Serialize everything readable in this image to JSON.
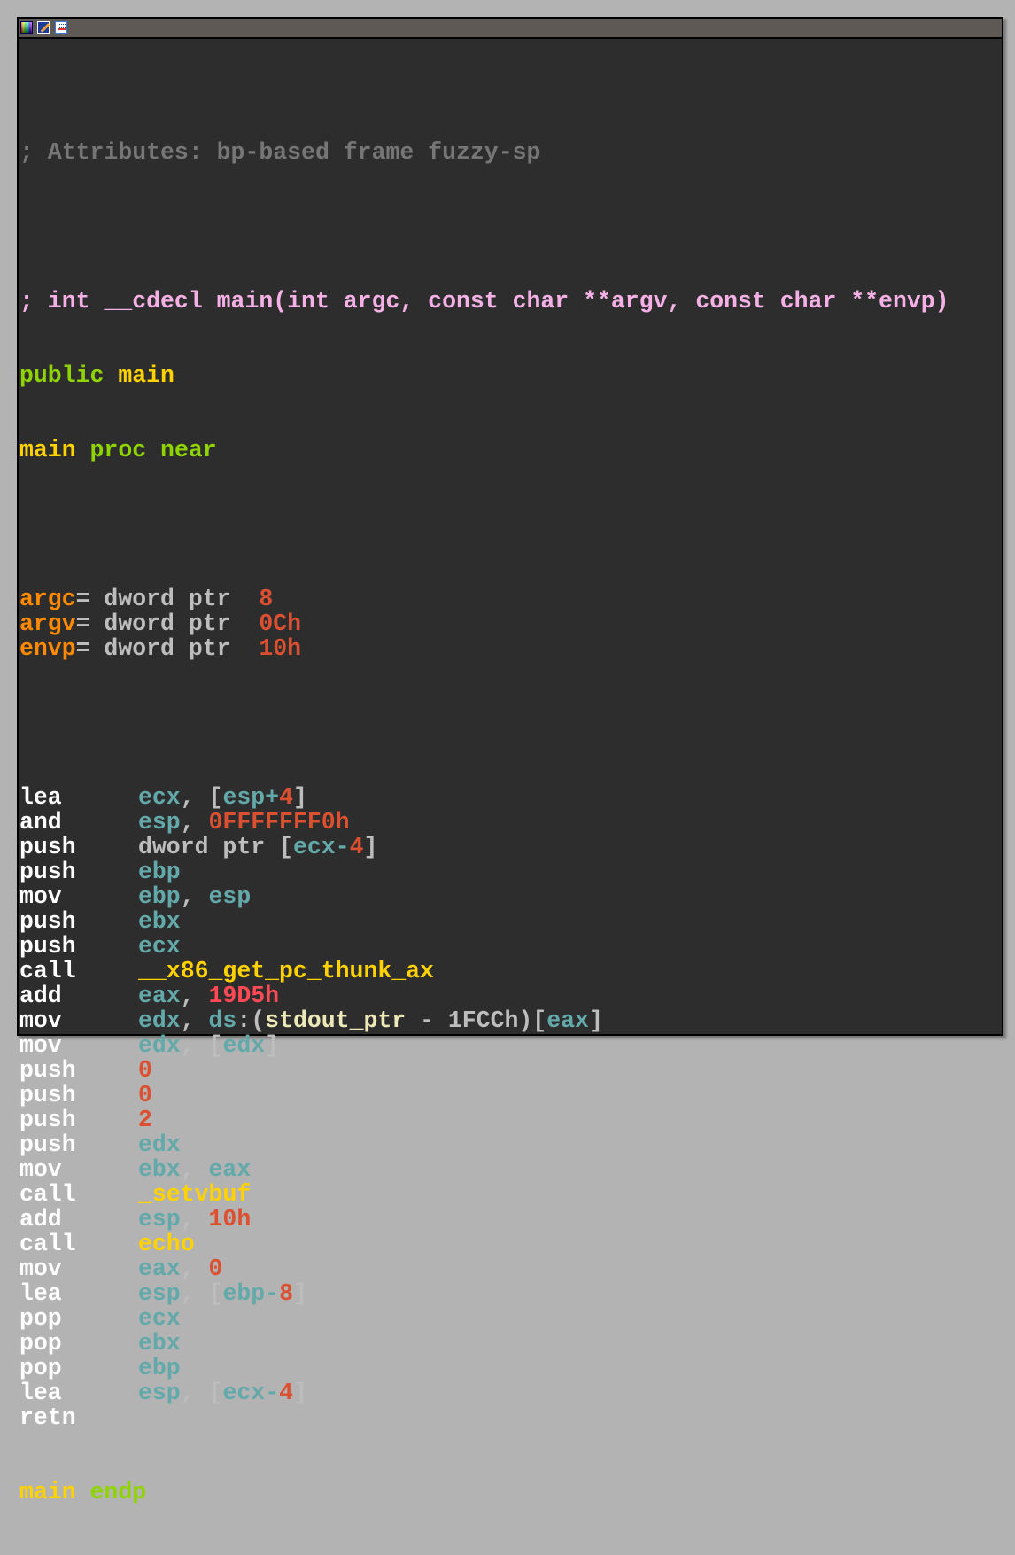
{
  "window": {
    "titlebar_icons": [
      "color-palette-icon",
      "pencil-edit-icon",
      "graph-view-icon"
    ]
  },
  "colors": {
    "background": "#2d2d2d",
    "comment": "#767676",
    "prototype": "#f5b1e6",
    "keyword": "#8fd400",
    "name": "#ffd200",
    "stack_var": "#ff8a00",
    "register": "#64a9aa",
    "number": "#dc5032",
    "mnemonic": "#ffffff"
  },
  "listing": {
    "attributes_comment": "; Attributes: bp-based frame fuzzy-sp",
    "prototype_comment": "; int __cdecl main(int argc, const char **argv, const char **envp)",
    "public_kw": "public",
    "public_name": "main",
    "proc_name": "main",
    "proc_kw": "proc near",
    "stack_vars": [
      {
        "name": "argc",
        "decl": "= dword ptr  ",
        "offset": "8"
      },
      {
        "name": "argv",
        "decl": "= dword ptr  ",
        "offset": "0Ch"
      },
      {
        "name": "envp",
        "decl": "= dword ptr  ",
        "offset": "10h"
      }
    ],
    "instructions": [
      {
        "mnemonic": "lea",
        "ops": [
          {
            "t": "reg",
            "v": "ecx"
          },
          {
            "t": "punct",
            "v": ", ["
          },
          {
            "t": "reg",
            "v": "esp"
          },
          {
            "t": "reg",
            "v": "+"
          },
          {
            "t": "num",
            "v": "4"
          },
          {
            "t": "punct",
            "v": "]"
          }
        ]
      },
      {
        "mnemonic": "and",
        "ops": [
          {
            "t": "reg",
            "v": "esp"
          },
          {
            "t": "punct",
            "v": ", "
          },
          {
            "t": "num",
            "v": "0FFFFFFF0h"
          }
        ]
      },
      {
        "mnemonic": "push",
        "ops": [
          {
            "t": "plain",
            "v": "dword ptr ["
          },
          {
            "t": "reg",
            "v": "ecx"
          },
          {
            "t": "reg",
            "v": "-"
          },
          {
            "t": "num",
            "v": "4"
          },
          {
            "t": "punct",
            "v": "]"
          }
        ]
      },
      {
        "mnemonic": "push",
        "ops": [
          {
            "t": "reg",
            "v": "ebp"
          }
        ]
      },
      {
        "mnemonic": "mov",
        "ops": [
          {
            "t": "reg",
            "v": "ebp"
          },
          {
            "t": "punct",
            "v": ", "
          },
          {
            "t": "reg",
            "v": "esp"
          }
        ]
      },
      {
        "mnemonic": "push",
        "ops": [
          {
            "t": "reg",
            "v": "ebx"
          }
        ]
      },
      {
        "mnemonic": "push",
        "ops": [
          {
            "t": "reg",
            "v": "ecx"
          }
        ]
      },
      {
        "mnemonic": "call",
        "ops": [
          {
            "t": "name",
            "v": "__x86_get_pc_thunk_ax"
          }
        ]
      },
      {
        "mnemonic": "add",
        "ops": [
          {
            "t": "reg",
            "v": "eax"
          },
          {
            "t": "punct",
            "v": ", "
          },
          {
            "t": "numhi",
            "v": "19D5h"
          }
        ]
      },
      {
        "mnemonic": "mov",
        "ops": [
          {
            "t": "reg",
            "v": "edx"
          },
          {
            "t": "punct",
            "v": ", "
          },
          {
            "t": "reg",
            "v": "ds"
          },
          {
            "t": "punct",
            "v": ":("
          },
          {
            "t": "sym",
            "v": "stdout_ptr"
          },
          {
            "t": "plain",
            "v": " - 1FCCh)["
          },
          {
            "t": "reg",
            "v": "eax"
          },
          {
            "t": "punct",
            "v": "]"
          }
        ]
      },
      {
        "mnemonic": "mov",
        "ops": [
          {
            "t": "reg",
            "v": "edx"
          },
          {
            "t": "punct",
            "v": ", ["
          },
          {
            "t": "reg",
            "v": "edx"
          },
          {
            "t": "punct",
            "v": "]"
          }
        ]
      },
      {
        "mnemonic": "push",
        "ops": [
          {
            "t": "num",
            "v": "0"
          }
        ]
      },
      {
        "mnemonic": "push",
        "ops": [
          {
            "t": "num",
            "v": "0"
          }
        ]
      },
      {
        "mnemonic": "push",
        "ops": [
          {
            "t": "num",
            "v": "2"
          }
        ]
      },
      {
        "mnemonic": "push",
        "ops": [
          {
            "t": "reg",
            "v": "edx"
          }
        ]
      },
      {
        "mnemonic": "mov",
        "ops": [
          {
            "t": "reg",
            "v": "ebx"
          },
          {
            "t": "punct",
            "v": ", "
          },
          {
            "t": "reg",
            "v": "eax"
          }
        ]
      },
      {
        "mnemonic": "call",
        "ops": [
          {
            "t": "name",
            "v": "_setvbuf"
          }
        ]
      },
      {
        "mnemonic": "add",
        "ops": [
          {
            "t": "reg",
            "v": "esp"
          },
          {
            "t": "punct",
            "v": ", "
          },
          {
            "t": "num",
            "v": "10h"
          }
        ]
      },
      {
        "mnemonic": "call",
        "ops": [
          {
            "t": "name",
            "v": "echo"
          }
        ]
      },
      {
        "mnemonic": "mov",
        "ops": [
          {
            "t": "reg",
            "v": "eax"
          },
          {
            "t": "punct",
            "v": ", "
          },
          {
            "t": "num",
            "v": "0"
          }
        ]
      },
      {
        "mnemonic": "lea",
        "ops": [
          {
            "t": "reg",
            "v": "esp"
          },
          {
            "t": "punct",
            "v": ", ["
          },
          {
            "t": "reg",
            "v": "ebp"
          },
          {
            "t": "reg",
            "v": "-"
          },
          {
            "t": "num",
            "v": "8"
          },
          {
            "t": "punct",
            "v": "]"
          }
        ]
      },
      {
        "mnemonic": "pop",
        "ops": [
          {
            "t": "reg",
            "v": "ecx"
          }
        ]
      },
      {
        "mnemonic": "pop",
        "ops": [
          {
            "t": "reg",
            "v": "ebx"
          }
        ]
      },
      {
        "mnemonic": "pop",
        "ops": [
          {
            "t": "reg",
            "v": "ebp"
          }
        ]
      },
      {
        "mnemonic": "lea",
        "ops": [
          {
            "t": "reg",
            "v": "esp"
          },
          {
            "t": "punct",
            "v": ", ["
          },
          {
            "t": "reg",
            "v": "ecx"
          },
          {
            "t": "reg",
            "v": "-"
          },
          {
            "t": "num",
            "v": "4"
          },
          {
            "t": "punct",
            "v": "]"
          }
        ]
      },
      {
        "mnemonic": "retn",
        "ops": []
      }
    ],
    "endp_name": "main",
    "endp_kw": "endp"
  }
}
